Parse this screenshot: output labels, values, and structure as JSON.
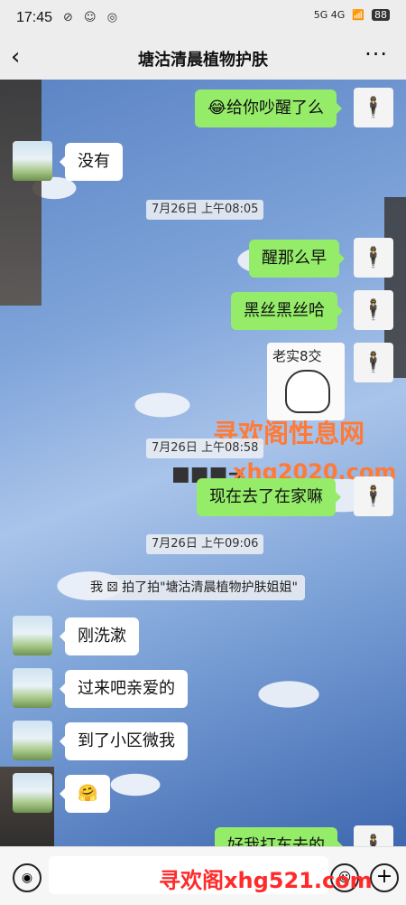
{
  "status": {
    "time": "17:45",
    "icons": "⊘ ☺ ◎",
    "network": "5G  4G",
    "battery": "88"
  },
  "header": {
    "back_icon": "‹",
    "title": "塘沽清晨植物护肤",
    "more_icon": "···"
  },
  "messages": {
    "m1": "😂给你吵醒了么",
    "m2": "没有",
    "t1": "7月26日 上午08:05",
    "m3": "醒那么早",
    "m4": "黑丝黑丝哈",
    "sticker_text": "老实8交",
    "t2": "7月26日 上午08:58",
    "m5": "现在去了在家嘛",
    "t3": "7月26日 上午09:06",
    "sys1": "我 ⚄ 拍了拍\"塘沽清晨植物护肤姐姐\"",
    "m6": "刚洗漱",
    "m7": "过来吧亲爱的",
    "m8": "到了小区微我",
    "m9": "🤗",
    "m10": "好我打车去的"
  },
  "watermarks": {
    "w1": "寻欢阁性息网",
    "w2": "xhg2020.com",
    "w3": "寻欢阁xhg521.com"
  },
  "colors": {
    "my_bubble": "#95ec69",
    "their_bubble": "#ffffff",
    "watermark": "#ff7a36"
  }
}
